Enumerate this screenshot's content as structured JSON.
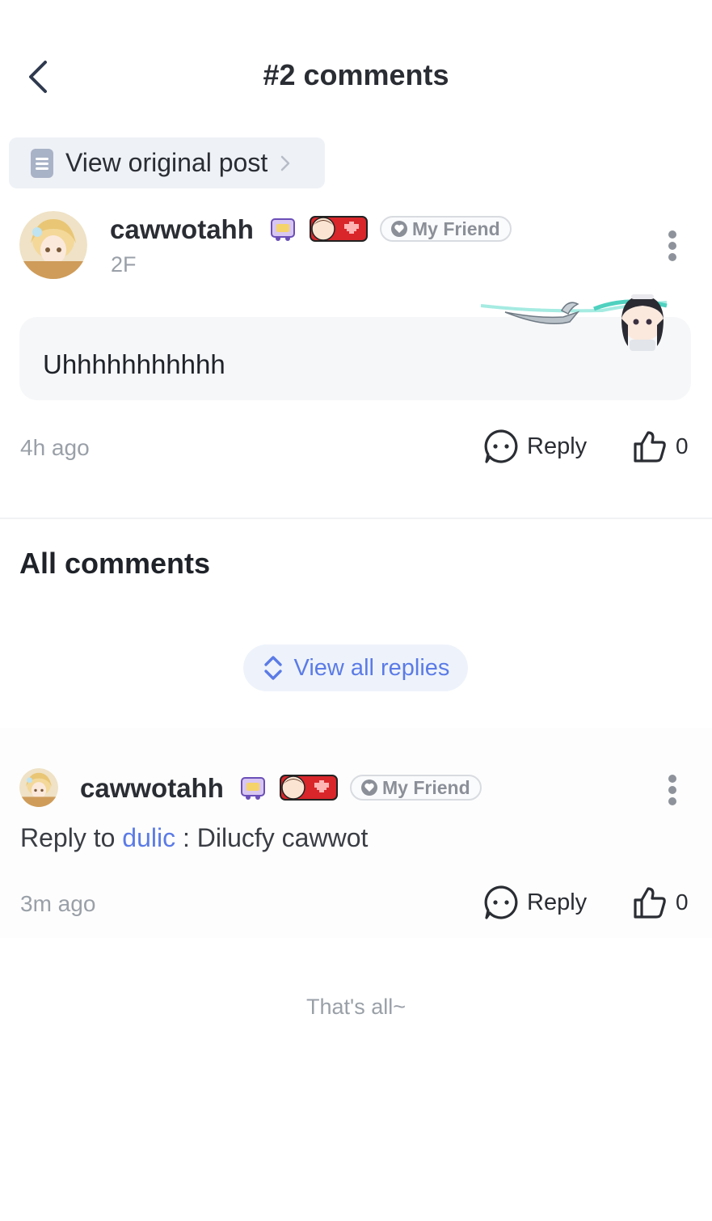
{
  "header": {
    "title": "#2 comments",
    "back_icon": "chevron-left-icon"
  },
  "view_original": {
    "label": "View original post",
    "icon": "document-icon"
  },
  "main_comment": {
    "username": "cawwotahh",
    "floor": "2F",
    "friend_tag": "My Friend",
    "content": "Uhhhhhhhhhhh",
    "time": "4h ago",
    "reply_label": "Reply",
    "like_count": "0"
  },
  "all_comments": {
    "title": "All comments",
    "view_all_label": "View all replies"
  },
  "reply": {
    "username": "cawwotahh",
    "friend_tag": "My Friend",
    "prefix": "Reply to",
    "mention": "dulic",
    "separator": " : ",
    "content": "Dilucfy cawwot",
    "time": "3m ago",
    "reply_label": "Reply",
    "like_count": "0"
  },
  "footer": {
    "end_text": "That's all~"
  },
  "colors": {
    "accent": "#5b7be6",
    "muted": "#9aa0a8",
    "pill_bg": "#eef1f6"
  }
}
